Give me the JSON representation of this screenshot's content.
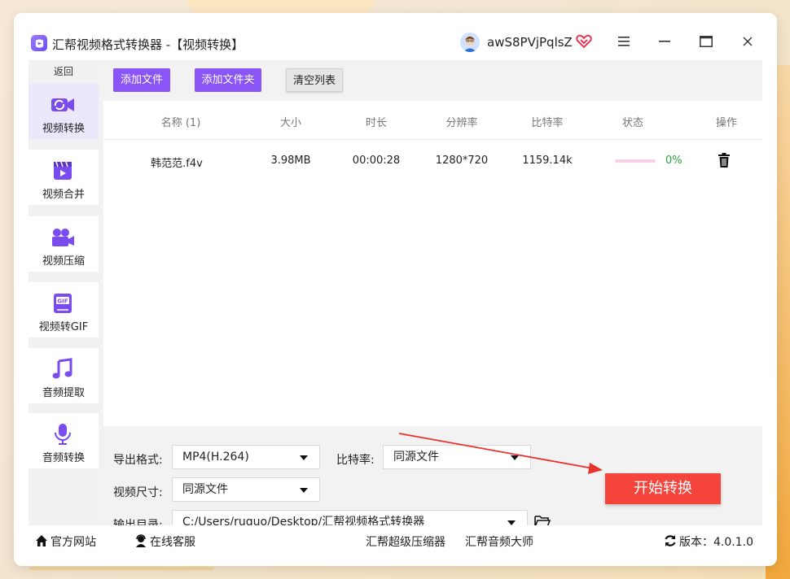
{
  "window": {
    "title": "汇帮视频格式转换器  -【视频转换】",
    "user_name": "awS8PVjPqlsZ"
  },
  "sidebar": {
    "back_label": "返回",
    "items": [
      {
        "label": "视频转换",
        "icon": "video-convert-icon",
        "active": true
      },
      {
        "label": "视频合并",
        "icon": "video-merge-icon"
      },
      {
        "label": "视频压缩",
        "icon": "video-compress-icon"
      },
      {
        "label": "视频转GIF",
        "icon": "gif-icon"
      },
      {
        "label": "音频提取",
        "icon": "music-note-icon"
      },
      {
        "label": "音频转换",
        "icon": "microphone-icon"
      }
    ]
  },
  "toolbar": {
    "add_file": "添加文件",
    "add_folder": "添加文件夹",
    "clear_list": "清空列表"
  },
  "table": {
    "columns": [
      "名称 (1)",
      "大小",
      "时长",
      "分辨率",
      "比特率",
      "状态",
      "操作"
    ],
    "rows": [
      {
        "name": "韩范范.f4v",
        "size": "3.98MB",
        "duration": "00:00:28",
        "resolution": "1280*720",
        "bitrate": "1159.14k",
        "progress": 0,
        "status": "0%"
      }
    ]
  },
  "settings": {
    "format_label": "导出格式:",
    "format_value": "MP4(H.264)",
    "bitrate_label": "比特率:",
    "bitrate_value": "同源文件",
    "size_label": "视频尺寸:",
    "size_value": "同源文件",
    "output_label": "输出目录:",
    "output_value": "C:/Users/ruguo/Desktop/汇帮视频格式转换器",
    "start_button": "开始转换"
  },
  "statusbar": {
    "website": "官方网站",
    "support": "在线客服",
    "link1": "汇帮超级压缩器",
    "link2": "汇帮音频大师",
    "version": "版本：4.0.1.0"
  },
  "colors": {
    "accent": "#8a55f7",
    "start": "#f4443c",
    "progress_ok": "#2aa13b",
    "arrow": "#e8322c"
  }
}
